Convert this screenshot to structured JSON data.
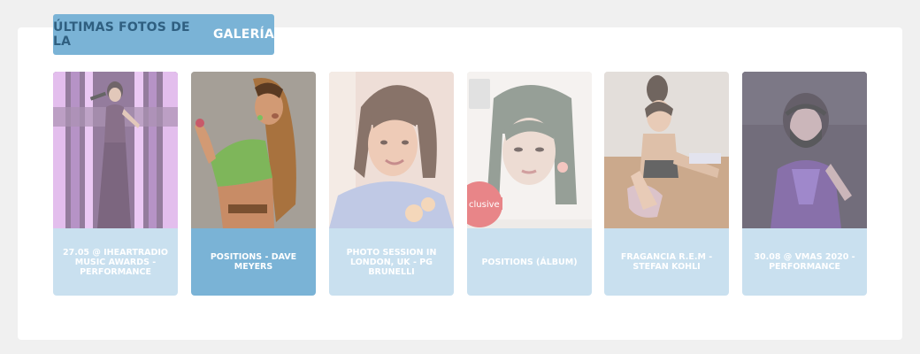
{
  "section": {
    "title_prefix": "ÚLTIMAS FOTOS DE LA",
    "title_suffix": "GALERÍA"
  },
  "colors": {
    "tag_bg": "#7ab3d6",
    "caption_bg": "#c9e0ef",
    "caption_active_bg": "#7ab3d6",
    "page_bg": "#f0f0f0"
  },
  "gallery": [
    {
      "caption": "27.05 @ IHEARTRADIO MUSIC AWARDS - PERFORMANCE",
      "active": false,
      "icon": "photo-thumbnail"
    },
    {
      "caption": "POSITIONS - DAVE MEYERS",
      "active": true,
      "icon": "photo-thumbnail"
    },
    {
      "caption": "PHOTO SESSION IN LONDON, UK - PG BRUNELLI",
      "active": false,
      "icon": "photo-thumbnail"
    },
    {
      "caption": "POSITIONS (ÁLBUM)",
      "active": false,
      "icon": "photo-thumbnail"
    },
    {
      "caption": "FRAGANCIA R.E.M - STEFAN KOHLI",
      "active": false,
      "icon": "photo-thumbnail"
    },
    {
      "caption": "30.08 @ VMAS 2020 - PERFORMANCE",
      "active": false,
      "icon": "photo-thumbnail"
    }
  ],
  "album_sticker": "clusive"
}
